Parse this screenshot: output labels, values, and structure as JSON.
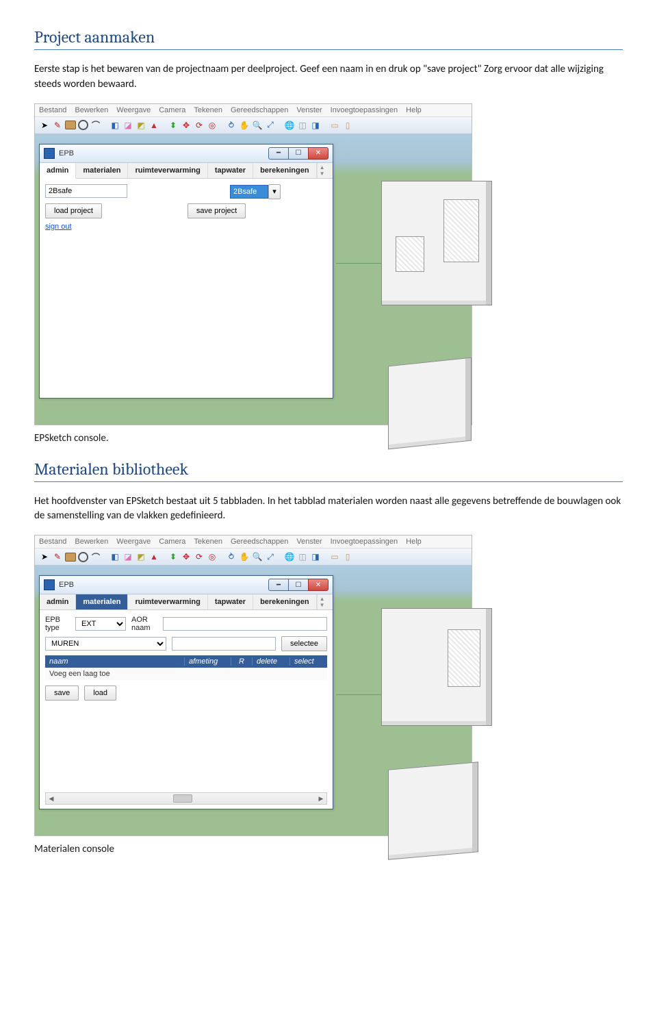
{
  "doc": {
    "h1": "Project aanmaken",
    "p1": "Eerste stap is het bewaren van de projectnaam per deelproject.  Geef een naam in en druk op \"save project\" Zorg ervoor dat alle wijziging steeds worden bewaard.",
    "cap1": "EPSketch console.",
    "h2": "Materialen bibliotheek",
    "p2": "Het hoofdvenster van EPSketch bestaat uit 5 tabbladen.  In het tabblad materialen worden naast alle gegevens betreffende  de bouwlagen ook de samenstelling van de vlakken gedefinieerd.",
    "cap2": "Materialen console"
  },
  "app": {
    "menu": [
      "Bestand",
      "Bewerken",
      "Weergave",
      "Camera",
      "Tekenen",
      "Gereedschappen",
      "Venster",
      "Invoegtoepassingen",
      "Help"
    ],
    "win_title": "EPB",
    "tabs": [
      "admin",
      "materialen",
      "ruimteverwarming",
      "tapwater",
      "berekeningen"
    ]
  },
  "admin": {
    "left_value": "2Bsafe",
    "right_value": "2Bsafe",
    "load_btn": "load project",
    "save_btn": "save project",
    "signout": "sign out"
  },
  "mat": {
    "epb_type_lbl": "EPB type",
    "epb_type_value": "EXT",
    "aor_lbl": "AOR naam",
    "aor_value": "",
    "type_select": "MUREN",
    "filter_value": "",
    "select_btn": "selectee",
    "cols": {
      "naam": "naam",
      "afm": "afmeting",
      "r": "R",
      "del": "delete",
      "sel": "select"
    },
    "row1": "Voeg een laag toe",
    "save_btn": "save",
    "load_btn": "load"
  }
}
